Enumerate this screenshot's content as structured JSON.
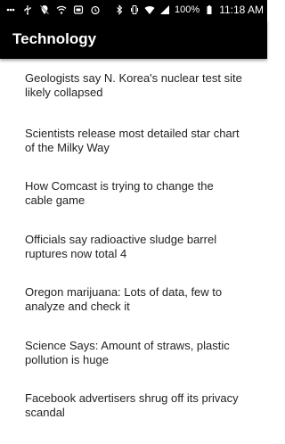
{
  "status_bar": {
    "battery_percent": "100%",
    "time": "11:18 AM",
    "left_icons": [
      "dots-icon",
      "usb-icon",
      "location-off-icon",
      "wifi-off-icon",
      "box-icon",
      "alarm-icon"
    ],
    "right_icons": [
      "bluetooth-icon",
      "vibrate-icon",
      "wifi-icon",
      "signal-icon",
      "battery-icon"
    ]
  },
  "app_bar": {
    "title": "Technology"
  },
  "articles": [
    {
      "title": "Geologists say N. Korea's nuclear test site likely collapsed"
    },
    {
      "title": "Scientists release most detailed star chart of the Milky Way"
    },
    {
      "title": "How Comcast is trying to change the cable game"
    },
    {
      "title": "Officials say radioactive sludge barrel ruptures now total 4"
    },
    {
      "title": "Oregon marijuana: Lots of data, few to analyze and check it"
    },
    {
      "title": "Science Says: Amount of straws, plastic pollution is huge"
    },
    {
      "title": "Facebook advertisers shrug off its privacy scandal"
    }
  ]
}
